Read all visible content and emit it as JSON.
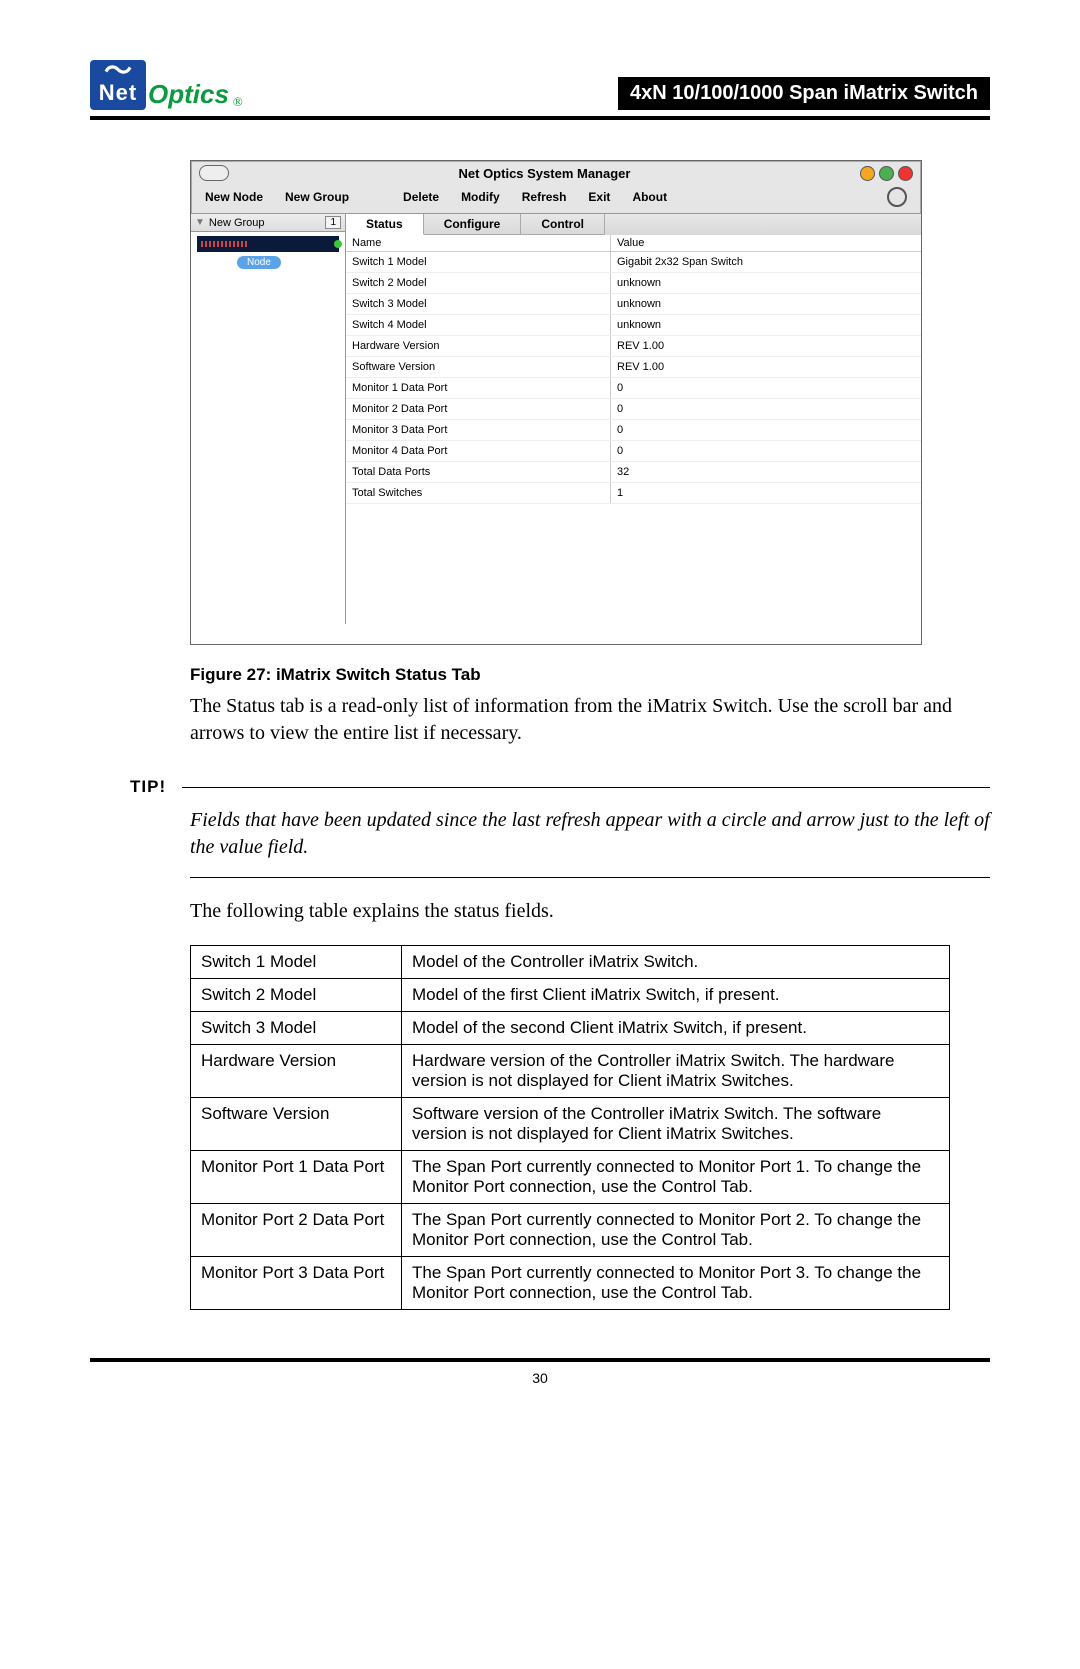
{
  "header": {
    "logo_net": "Net",
    "logo_optics": "Optics",
    "reg": "®",
    "title_bar": "4xN 10/100/1000 Span iMatrix Switch"
  },
  "screenshot": {
    "window_title": "Net Optics System Manager",
    "menu": [
      "New Node",
      "New Group",
      "Delete",
      "Modify",
      "Refresh",
      "Exit",
      "About"
    ],
    "tree": {
      "group_label": "New Group",
      "count": "1",
      "node_label": "Node"
    },
    "tabs": [
      "Status",
      "Configure",
      "Control"
    ],
    "active_tab": "Status",
    "table_headers": {
      "name": "Name",
      "value": "Value"
    },
    "rows": [
      {
        "name": "Switch 1 Model",
        "value": "Gigabit 2x32 Span Switch"
      },
      {
        "name": "Switch 2 Model",
        "value": "unknown"
      },
      {
        "name": "Switch 3 Model",
        "value": "unknown"
      },
      {
        "name": "Switch 4 Model",
        "value": "unknown"
      },
      {
        "name": "Hardware Version",
        "value": "REV 1.00"
      },
      {
        "name": "Software Version",
        "value": "REV 1.00"
      },
      {
        "name": "Monitor 1 Data Port",
        "value": "0"
      },
      {
        "name": "Monitor 2 Data Port",
        "value": "0"
      },
      {
        "name": "Monitor 3 Data Port",
        "value": "0"
      },
      {
        "name": "Monitor 4 Data Port",
        "value": "0"
      },
      {
        "name": "Total Data Ports",
        "value": "32"
      },
      {
        "name": "Total Switches",
        "value": "1"
      }
    ]
  },
  "caption": "Figure 27: iMatrix Switch Status Tab",
  "paragraph1": "The Status tab is a read-only list of information from the iMatrix Switch. Use the scroll bar and arrows to view the entire list if necessary.",
  "tip_label": "TIP!",
  "tip_text": "Fields that have been updated since the last refresh appear with a circle and arrow just to the left of the value field.",
  "paragraph2": "The following table explains the status fields.",
  "fields_table": [
    {
      "name": "Switch 1 Model",
      "desc": "Model of the Controller iMatrix Switch."
    },
    {
      "name": "Switch 2 Model",
      "desc": "Model of the first Client iMatrix Switch, if present."
    },
    {
      "name": "Switch 3 Model",
      "desc": "Model of the second Client iMatrix Switch, if present."
    },
    {
      "name": "Hardware Version",
      "desc": "Hardware version of the Controller iMatrix Switch. The hardware version is not displayed for Client iMatrix Switches."
    },
    {
      "name": "Software Version",
      "desc": "Software version of the Controller iMatrix Switch. The software version is not displayed for Client iMatrix Switches."
    },
    {
      "name": "Monitor Port 1 Data Port",
      "desc": "The Span Port currently connected to Monitor Port 1. To change the Monitor Port connection, use the Control Tab."
    },
    {
      "name": "Monitor Port 2 Data Port",
      "desc": "The Span Port currently connected to Monitor Port 2. To change the Monitor Port connection, use the Control Tab."
    },
    {
      "name": "Monitor Port 3 Data Port",
      "desc": "The Span Port currently connected to Monitor Port 3. To change the Monitor Port connection, use the Control Tab."
    }
  ],
  "page_number": "30"
}
